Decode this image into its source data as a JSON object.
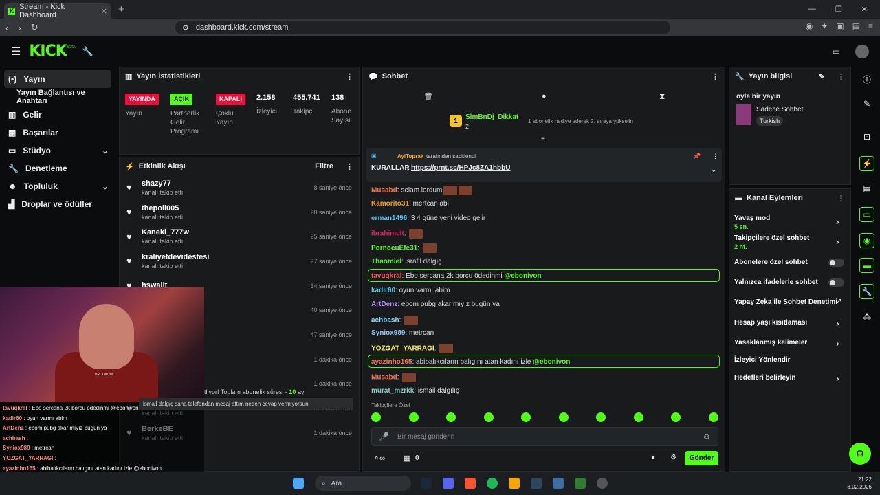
{
  "browser": {
    "tab_title": "Stream - Kick Dashboard",
    "url": "dashboard.kick.com/stream"
  },
  "brand": {
    "logo": "KICK",
    "beta": "BETA",
    "accent": "#53fc18"
  },
  "sidebar": {
    "items": [
      {
        "label": "Yayın",
        "icon": "broadcast-icon"
      },
      {
        "label": "Yayın Bağlantısı ve Anahtarı",
        "icon": ""
      },
      {
        "label": "Gelir",
        "icon": "chart-icon"
      },
      {
        "label": "Başarılar",
        "icon": "trophy-icon"
      },
      {
        "label": "Stüdyo",
        "icon": "studio-icon"
      },
      {
        "label": "Denetleme",
        "icon": "wrench-icon"
      },
      {
        "label": "Topluluk",
        "icon": "community-icon"
      },
      {
        "label": "Droplar ve ödüller",
        "icon": "gift-icon"
      }
    ]
  },
  "stats": {
    "title": "Yayın İstatistikleri",
    "badges": [
      {
        "badge": "YAYINDA",
        "label": "Yayın"
      },
      {
        "badge": "AÇIK",
        "label": "Partnerlik Gelir Programı"
      },
      {
        "badge": "KAPALI",
        "label": "Çoklu Yayın"
      }
    ],
    "numbers": [
      {
        "value": "2.158",
        "label": "İzleyici"
      },
      {
        "value": "455.741",
        "label": "Takipçi"
      },
      {
        "value": "138",
        "label": "Abone Sayısı"
      }
    ]
  },
  "activity": {
    "title": "Etkinlik Akışı",
    "filter": "Filtre",
    "items": [
      {
        "name": "shazy77",
        "sub": "kanalı takip etti",
        "time": "8 saniye önce"
      },
      {
        "name": "thepoli005",
        "sub": "kanalı takip etti",
        "time": "20 saniye önce"
      },
      {
        "name": "Kaneki_777w",
        "sub": "kanalı takip etti",
        "time": "25 saniye önce"
      },
      {
        "name": "kraliyetdevidestesi",
        "sub": "kanalı takip etti",
        "time": "27 saniye önce"
      },
      {
        "name": "hswalit",
        "sub": "",
        "time": "34 saniye önce"
      },
      {
        "name": "",
        "sub": "",
        "time": "40 saniye önce"
      },
      {
        "name": "",
        "sub": "",
        "time": "47 saniye önce"
      },
      {
        "name": "",
        "sub": "",
        "time": "1 dakika önce"
      },
      {
        "name": "",
        "sub": "",
        "time": "1 dakika önce"
      }
    ],
    "partial_msg": "tliyor! Toplam abonelik süresi - ",
    "partial_num": "10",
    "partial_end": " ay!",
    "overlay_msg": "ismail dalgıç sana telefondan mesaj attım neden cevap vermiyorsun",
    "late": [
      {
        "name": "PSGFannEskort",
        "sub": "kanalı takip etti",
        "time": "1 dakika önce"
      },
      {
        "name": "BerkeBE",
        "sub": "kanalı takip etti",
        "time": "1 dakika önce"
      }
    ]
  },
  "chat": {
    "title": "Sohbet",
    "gifter": "SlmBnDj_Dikkat",
    "gifter_count": "2",
    "gift_rank": "1",
    "gift_text": "1 abonelik hediye ederek 2. sıraya yükselin",
    "pinned_by": "AyiToprak",
    "pinned_suffix": "tarafından sabitlendi",
    "pinned_label": "KURALLAR",
    "pinned_link": "https://prnt.sc/HPJc8ZA1hbbU",
    "messages": [
      {
        "user": "Musabd",
        "text": "selam lordum",
        "color": "#ff7043"
      },
      {
        "user": "Kamorito31",
        "text": "mertcan abi",
        "color": "#ff9800"
      },
      {
        "user": "erman1496",
        "text": "3 4 güne yeni video gelir",
        "color": "#4fc3f7"
      },
      {
        "user": "ibrahimclt",
        "text": "",
        "color": "#e91e63"
      },
      {
        "user": "PornocuEfe31",
        "text": "",
        "color": "#53fc18"
      },
      {
        "user": "Thaomiel",
        "text": "israfil dalgıç",
        "color": "#53fc18"
      },
      {
        "user": "tavuqkral",
        "text": "Ebo sercana 2k borcu ödedinmi ",
        "color": "#ff5252",
        "mention": "@ebonivon"
      },
      {
        "user": "kadir60",
        "text": "oyun varmı abim",
        "color": "#4dd0e1"
      },
      {
        "user": "ArtDenz",
        "text": "ebom pubg akar mıyız bugün ya",
        "color": "#b388ff"
      },
      {
        "user": "achbash",
        "text": "",
        "color": "#80d8ff"
      },
      {
        "user": "Syniox989",
        "text": "metrcan",
        "color": "#90caf9"
      },
      {
        "user": "YOZGAT_YARRAGI",
        "text": "",
        "color": "#ffee58"
      },
      {
        "user": "ayazinho165",
        "text": "abibalıkcıların balıgını atan kadını izle ",
        "color": "#ff7043",
        "mention": "@ebonivon"
      },
      {
        "user": "Musabd",
        "text": "",
        "color": "#ff7043"
      },
      {
        "user": "murat_mzrkk",
        "text": "ismail dalgılıç",
        "color": "#80cbc4"
      }
    ],
    "followers_only": "Takipçilere Özel",
    "input_placeholder": "Bir mesaj gönderin",
    "count": "0",
    "send": "Gönder"
  },
  "info": {
    "title": "Yayın bilgisi",
    "stream_title": "öyle bir yayın",
    "category": "Sadece Sohbet",
    "language": "Turkish"
  },
  "actions": {
    "title": "Kanal Eylemleri",
    "items": [
      {
        "label": "Yavaş mod",
        "sub": "5 sn."
      },
      {
        "label": "Takipçilere özel sohbet",
        "sub": "2 hf."
      },
      {
        "label": "Abonelere özel sohbet",
        "sub": ""
      },
      {
        "label": "Yalnızca ifadelerle sohbet",
        "sub": ""
      },
      {
        "label": "Yapay Zeka ile Sohbet Denetimi",
        "sub": ""
      },
      {
        "label": "Hesap yaşı kısıtlaması",
        "sub": ""
      },
      {
        "label": "Yasaklanmış kelimeler",
        "sub": ""
      },
      {
        "label": "İzleyici Yönlendir",
        "sub": ""
      },
      {
        "label": "Hedefleri belirleyin",
        "sub": ""
      }
    ]
  },
  "overlay_chat": [
    {
      "user": "tavuqkral",
      "text": "Ebo sercana 2k borcu ödedinmi @ebonivon"
    },
    {
      "user": "kadir60",
      "text": "oyun varmı abim"
    },
    {
      "user": "ArtDenz",
      "text": "ebom pubg akar mıyız bugün ya"
    },
    {
      "user": "achbash",
      "text": ""
    },
    {
      "user": "Syniox989",
      "text": "metrcan"
    },
    {
      "user": "YOZGAT_YARRAGI",
      "text": ""
    },
    {
      "user": "ayazinho165",
      "text": "abibalıkcıların balıgını atan kadını izle @ebonivon"
    },
    {
      "user": "Musabd",
      "text": ""
    },
    {
      "user": "murat_mzrkk",
      "text": "ismail dalgılıç"
    }
  ],
  "webcam_shirt": "BROOKLYN",
  "taskbar": {
    "search": "Ara",
    "time": "21:22",
    "date": "8.02.2026"
  }
}
